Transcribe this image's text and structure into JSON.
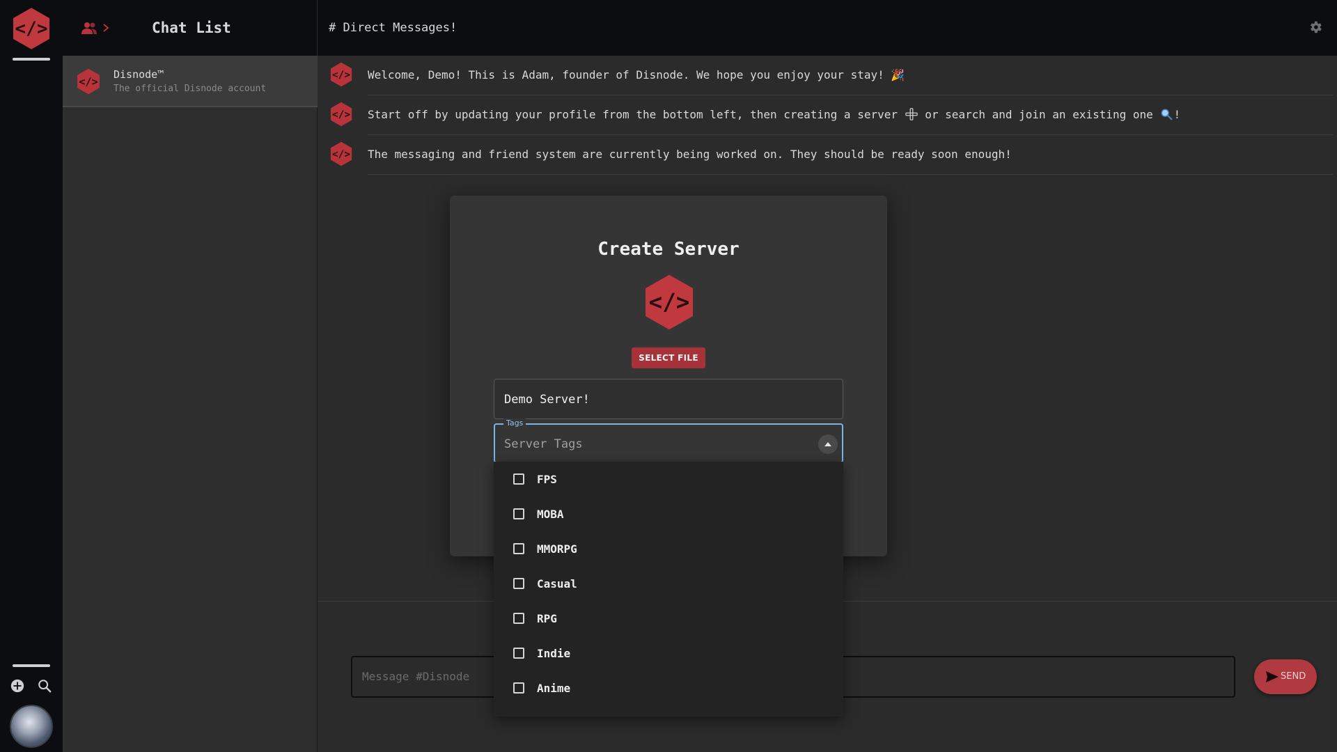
{
  "chat_list": {
    "title": "Chat List",
    "items": [
      {
        "name": "Disnode™",
        "subtitle": "The official Disnode account"
      }
    ]
  },
  "header": {
    "channel_title": "# Direct Messages!"
  },
  "messages": [
    {
      "text": "Welcome, Demo! This is Adam, founder of Disnode. We hope you enjoy your stay! 🎉"
    },
    {
      "text_before": "Start off by updating your profile from the bottom left, then creating a server",
      "text_middle": " or search and join an existing one",
      "text_after": "!"
    },
    {
      "text": "The messaging and friend system are currently being worked on. They should be ready soon enough!"
    }
  ],
  "composer": {
    "placeholder": "Message #Disnode",
    "send_label": "SEND"
  },
  "modal": {
    "title": "Create Server",
    "select_file_label": "SELECT FILE",
    "server_name_value": "Demo Server!",
    "tags_label": "Tags",
    "tags_placeholder": "Server Tags",
    "tag_options": [
      "FPS",
      "MOBA",
      "MMORPG",
      "Casual",
      "RPG",
      "Indie",
      "Anime"
    ]
  },
  "colors": {
    "brand_red": "#c0393f",
    "focus_blue": "#7fb3e6",
    "sidebar_bg": "#0b0d10",
    "panel_bg": "#2e2e2e"
  },
  "icons": {
    "logo": "disnode-hex-code-icon",
    "friends": "friends-icon",
    "settings": "gear-icon",
    "add": "add-circle-icon",
    "search": "search-icon",
    "send": "send-icon"
  }
}
